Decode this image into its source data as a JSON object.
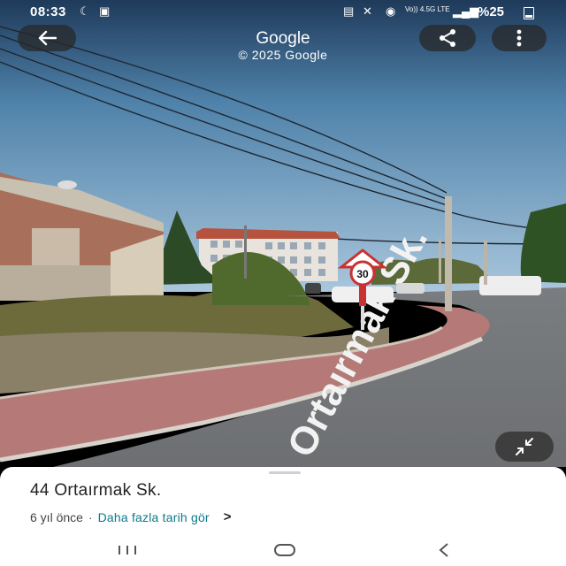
{
  "status_bar": {
    "time": "08:33",
    "network_label": "Vo)) 4.5G LTE",
    "battery_text": "%25"
  },
  "header": {
    "title": "Google",
    "subtitle": "© 2025 Google"
  },
  "scene": {
    "street_text": "Ortaırmak Sk.",
    "speed_limit": "30"
  },
  "place": {
    "name": "44 Ortaırmak Sk.",
    "age": "6 yıl önce",
    "separator": "·",
    "history_link": "Daha fazla tarih gör",
    "chevron": ">"
  },
  "icons": {
    "back": "arrow-left-icon",
    "share": "share-icon",
    "more": "more-vertical-icon",
    "compass": "collapse-arrows-icon"
  },
  "colors": {
    "link": "#0b7a8a",
    "sky": "#5b8fb5"
  }
}
